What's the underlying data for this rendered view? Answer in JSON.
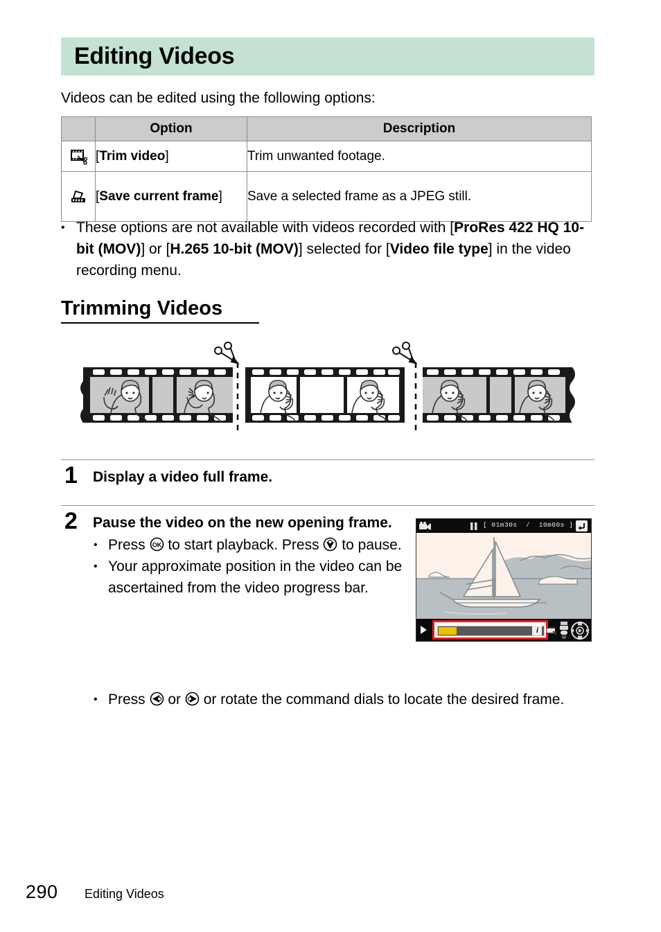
{
  "page": {
    "title": "Editing Videos",
    "intro": "Videos can be edited using the following options:",
    "footer_page_number": "290",
    "footer_section": "Editing Videos",
    "title_band_color": "#c3e2d3",
    "table_header_color": "#cccccc"
  },
  "options_table": {
    "headers": {
      "icon": "",
      "option": "Option",
      "description": "Description"
    },
    "rows": [
      {
        "icon_name": "trim-video-icon",
        "option_prefix": "[",
        "option_label": "Trim video",
        "option_suffix": "]",
        "description": "Trim unwanted footage."
      },
      {
        "icon_name": "save-current-frame-icon",
        "option_prefix": "[",
        "option_label": "Save current frame",
        "option_suffix": "]",
        "description": "Save a selected frame as a JPEG still."
      }
    ]
  },
  "note": {
    "bullet": "•",
    "part1": "These options are not available with videos recorded with [",
    "bold1": "ProRes 422 HQ 10-bit (MOV)",
    "part2": "] or [",
    "bold2": "H.265 10-bit (MOV)",
    "part3": "] selected for [",
    "bold3": "Video file type",
    "part4": "] in the video recording menu."
  },
  "section": {
    "heading": "Trimming Videos"
  },
  "illustration": {
    "name": "film-strip-trimming-diagram",
    "scissors_count": 2,
    "segments": 3,
    "caption": ""
  },
  "steps": [
    {
      "number": "1",
      "heading": "Display a video full frame.",
      "bullets": []
    },
    {
      "number": "2",
      "heading": "Pause the video on the new opening frame.",
      "bullets": [
        {
          "part1": "Press ",
          "icon1": "ok-button-icon",
          "part2": " to start playback. Press ",
          "icon2": "multi-selector-down-icon",
          "part3": " to pause."
        },
        {
          "part1": "Your approximate position in the video can be ascertained from the video progress bar."
        },
        {
          "part1": "Press ",
          "icon1": "multi-selector-left-icon",
          "part2": " or ",
          "icon2": "multi-selector-right-icon",
          "part3": " or rotate the command dials to locate the desired frame."
        }
      ]
    }
  ],
  "camera_monitor": {
    "name": "video-playback-screen",
    "movie_icon": "movie-camera-icon",
    "pause_indicator": "▐▐",
    "elapsed_time": "01m30s",
    "time_separator": "/",
    "total_time": "10m00s",
    "bracket_open": "[",
    "bracket_close": "]",
    "back_icon": "return-arrow-icon",
    "play_icon": "play-triangle-icon",
    "progress_percent": 15,
    "progress_fill_color": "#f0c000",
    "highlight_color": "#e8191c",
    "info_icon_label": "i",
    "info_icon_separator": ":",
    "trim_icon": "trim-icon",
    "volume_label": "▒",
    "dial_icon": "multi-selector-dial-icon",
    "scene_description": "sailboat on water with hills"
  }
}
